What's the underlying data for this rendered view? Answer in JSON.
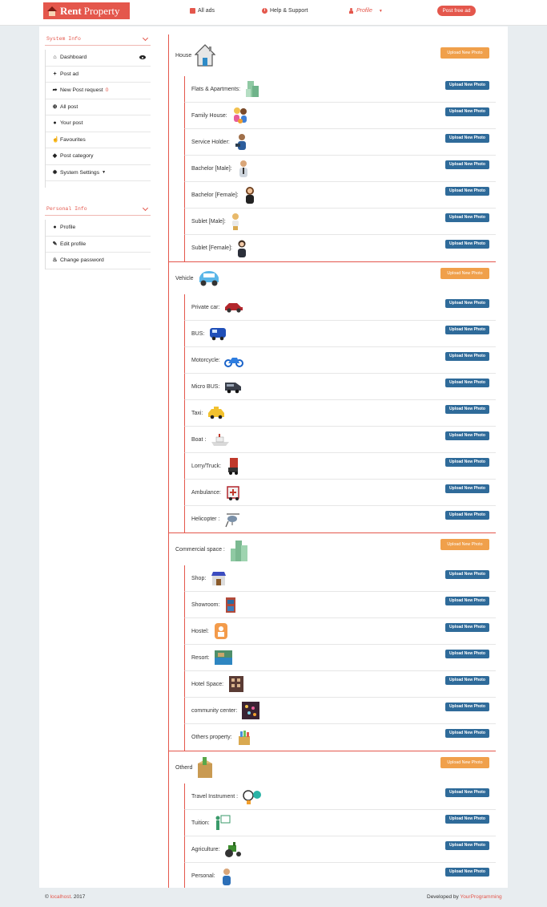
{
  "header": {
    "logo_word1": "Rent",
    "logo_word2": "Property",
    "all_ads": "All ads",
    "help": "Help & Support",
    "profile": "Profile",
    "post_free_ad": "Post free ad"
  },
  "sidebar": {
    "system_title": "System Info",
    "system_items": [
      {
        "label": "Dashboard",
        "icon": "home-icon"
      },
      {
        "label": "Post ad",
        "icon": "plus-icon"
      },
      {
        "label": "New Post request",
        "icon": "share-icon",
        "badge": "0"
      },
      {
        "label": "All post",
        "icon": "zoom-icon"
      },
      {
        "label": "Your post",
        "icon": "user-icon"
      },
      {
        "label": "Favourites",
        "icon": "thumbs-up-icon"
      },
      {
        "label": "Post category",
        "icon": "tag-icon"
      },
      {
        "label": "System Settings",
        "icon": "cog-icon"
      }
    ],
    "personal_title": "Personal Info",
    "personal_items": [
      {
        "label": "Profile",
        "icon": "user-icon"
      },
      {
        "label": "Edit profile",
        "icon": "edit-icon"
      },
      {
        "label": "Change password",
        "icon": "fire-icon"
      }
    ]
  },
  "buttons": {
    "upload_main": "Upload New Photo",
    "upload_sub": "Upload New Photo"
  },
  "categories": [
    {
      "name": "House",
      "subs": [
        "Flats & Apartments:",
        "Family House:",
        "Service Holder:",
        "Bachelor [Male]:",
        "Bachelor [Female]:",
        "Sublet [Male]:",
        "Sublet [Female]:"
      ]
    },
    {
      "name": "Vehicle",
      "subs": [
        "Private car:",
        "BUS:",
        "Motorcycle:",
        "Micro BUS:",
        "Taxi:",
        "Boat :",
        "Lorry/Truck:",
        "Ambulance:",
        "Helicopter :"
      ]
    },
    {
      "name": "Commercial space :",
      "subs": [
        "Shop:",
        "Showroom:",
        "Hostel:",
        "Resort:",
        "Hotel Space:",
        "community center:",
        "Others property:"
      ]
    },
    {
      "name": "Otherd",
      "subs": [
        "Travel Instrument :",
        "Tuition:",
        "Agriculture:",
        "Personal:"
      ]
    }
  ],
  "footer": {
    "copyright_symbol": "©",
    "host": "localhost",
    "year": ". 2017",
    "developed_by": "Developed by",
    "developer": "YourProgramming"
  }
}
